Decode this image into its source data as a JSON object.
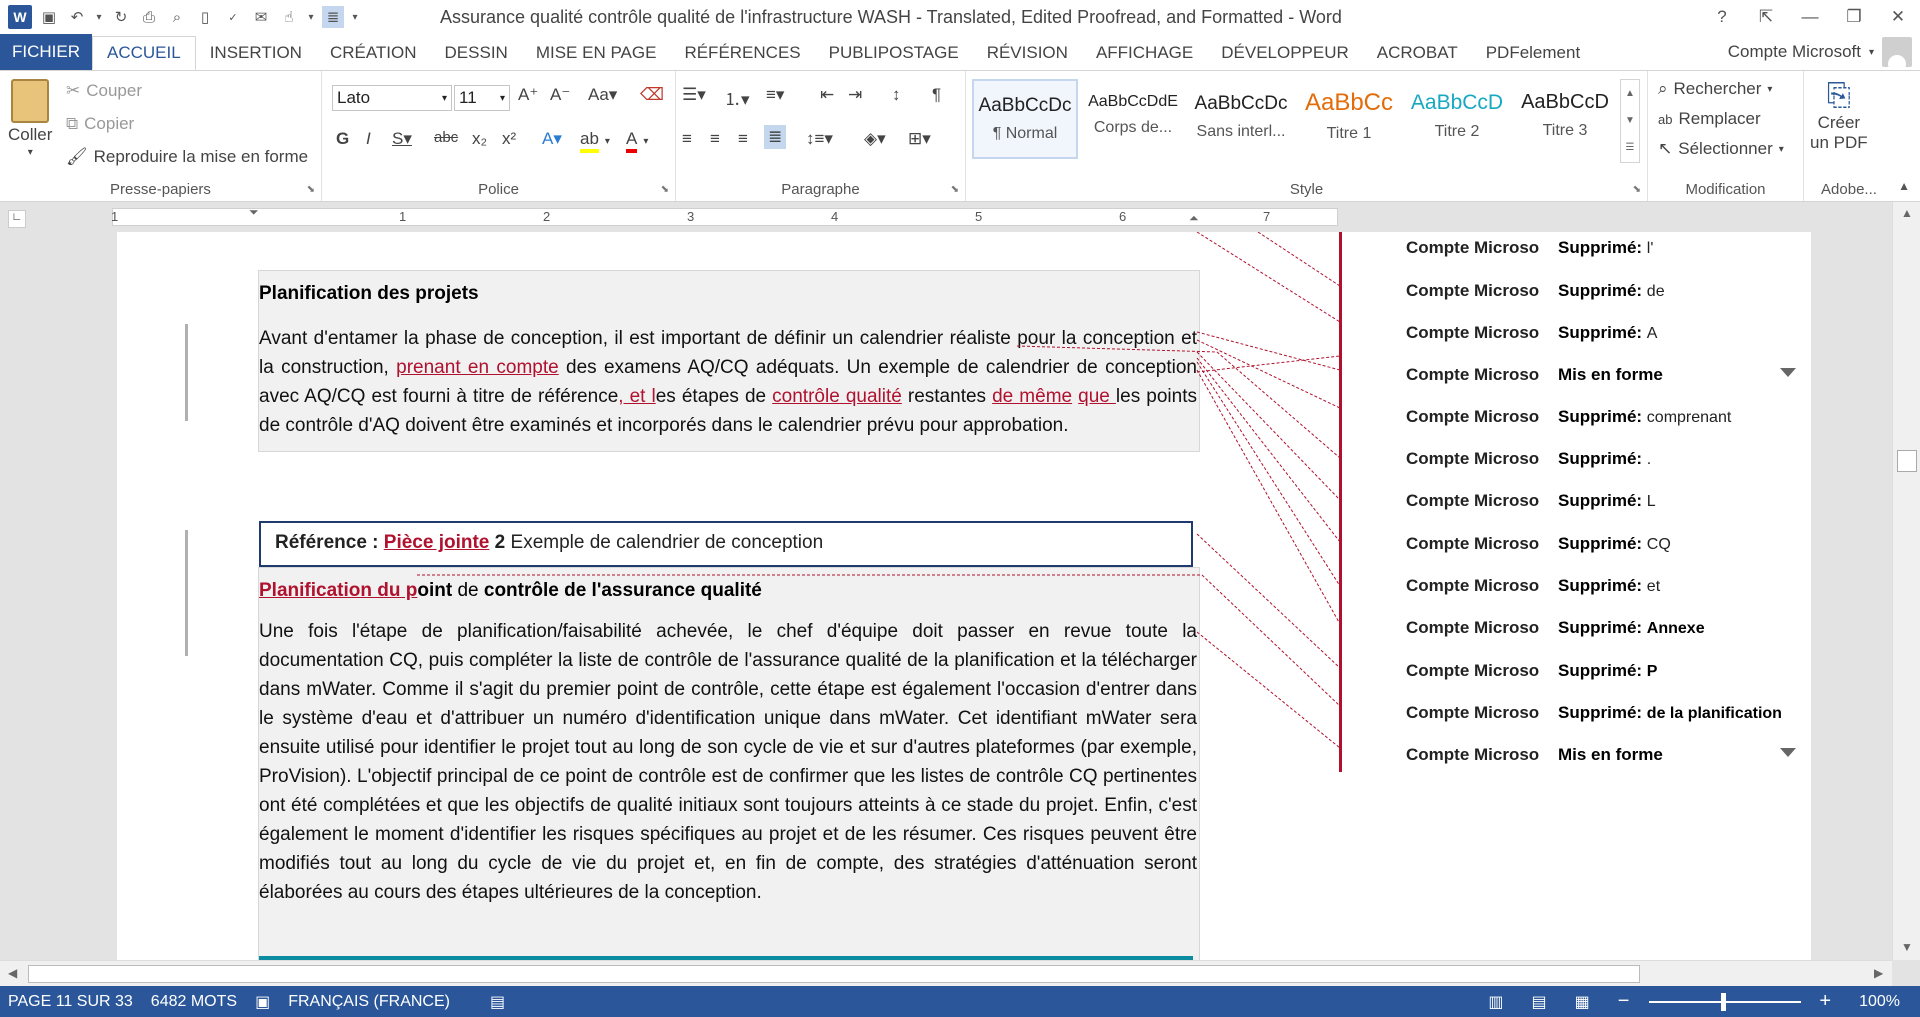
{
  "window": {
    "title": "Assurance qualité  contrôle qualité de l'infrastructure WASH - Translated, Edited Proofread, and Formatted - Word",
    "help": "?",
    "minimize": "—",
    "maximize": "❐",
    "close": "✕"
  },
  "tabs": [
    "FICHIER",
    "ACCUEIL",
    "INSERTION",
    "CRÉATION",
    "DESSIN",
    "MISE EN PAGE",
    "RÉFÉRENCES",
    "PUBLIPOSTAGE",
    "RÉVISION",
    "AFFICHAGE",
    "DÉVELOPPEUR",
    "ACROBAT",
    "PDFelement"
  ],
  "account": "Compte Microsoft",
  "ribbon": {
    "clipboard": {
      "paste": "Coller",
      "cut": "Couper",
      "copy": "Copier",
      "format_painter": "Reproduire la mise en forme",
      "label": "Presse-papiers"
    },
    "font": {
      "name": "Lato",
      "size": "11",
      "label": "Police"
    },
    "paragraph": {
      "label": "Paragraphe"
    },
    "styles": {
      "label": "Style",
      "items": [
        {
          "preview": "AaBbCcDc",
          "name": "¶ Normal"
        },
        {
          "preview": "AaBbCcDdE",
          "name": "Corps de..."
        },
        {
          "preview": "AaBbCcDc",
          "name": "Sans interl..."
        },
        {
          "preview": "AaBbCc",
          "name": "Titre 1"
        },
        {
          "preview": "AaBbCcD",
          "name": "Titre 2"
        },
        {
          "preview": "AaBbCcD",
          "name": "Titre 3"
        }
      ]
    },
    "editing": {
      "find": "Rechercher",
      "replace": "Remplacer",
      "select": "Sélectionner",
      "label": "Modification"
    },
    "adobe": {
      "create_pdf_1": "Créer",
      "create_pdf_2": "un PDF",
      "label": "Adobe..."
    }
  },
  "ruler": [
    "1",
    "1",
    "2",
    "3",
    "4",
    "5",
    "6",
    "7"
  ],
  "document": {
    "heading1": "Planification des projets",
    "para1_a": "Avant d'entamer la phase de conception, il est important de définir un calendrier réaliste pour la conception et la construction, ",
    "para1_ins1": "prenant en compte",
    "para1_b": " des examens AQ/CQ adéquats. Un exemple de calendrier de conception avec AQ/CQ est fourni à titre de référence",
    "para1_ins2": ", et l",
    "para1_c": "es étapes de ",
    "para1_ins3": "contrôle qualité",
    "para1_d": " restantes ",
    "para1_ins4": "de même",
    "para1_e": " ",
    "para1_ins5": "que ",
    "para1_f": "les points de contrôle d'AQ doivent être examinés et incorporés dans le calendrier prévu pour approbation.",
    "ref_label": "Référence : ",
    "ref_ins": "Pièce jointe",
    "ref_num": " 2 ",
    "ref_text": "Exemple de calendrier de conception",
    "heading2_ins": "Planification du p",
    "heading2_a": "oint",
    "heading2_b": " de ",
    "heading2_c": "contrôle de l'assurance qualité",
    "para2": "Une fois l'étape de planification/faisabilité achevée, le chef d'équipe doit passer en revue toute la documentation CQ, puis compléter la liste de contrôle de l'assurance qualité de la planification et la télécharger dans mWater. Comme il s'agit du premier point de contrôle, cette étape est également l'occasion d'entrer dans le système d'eau et d'attribuer un numéro d'identification unique dans mWater. Cet identifiant mWater sera ensuite utilisé pour identifier le projet tout au long de son cycle de vie et sur d'autres plateformes (par exemple, ProVision). L'objectif principal de ce point de contrôle est de confirmer que les listes de contrôle CQ pertinentes ont été complétées et que les objectifs de qualité initiaux sont toujours atteints à ce stade du projet. Enfin, c'est également le moment d'identifier les risques spécifiques au projet et de les résumer. Ces risques peuvent être modifiés tout au long du cycle de vie du projet et, en fin de compte, des stratégies d'atténuation seront élaborées au cours des étapes ultérieures de la conception."
  },
  "revisions": [
    {
      "author": "Compte Microso",
      "kind": "Supprimé:",
      "text": "l'"
    },
    {
      "author": "Compte Microso",
      "kind": "Supprimé:",
      "text": "de"
    },
    {
      "author": "Compte Microso",
      "kind": "Supprimé:",
      "text": "A"
    },
    {
      "author": "Compte Microso",
      "kind": "Mis en forme",
      "text": ""
    },
    {
      "author": "Compte Microso",
      "kind": "Supprimé:",
      "text": "comprenant"
    },
    {
      "author": "Compte Microso",
      "kind": "Supprimé:",
      "text": "."
    },
    {
      "author": "Compte Microso",
      "kind": "Supprimé:",
      "text": "L"
    },
    {
      "author": "Compte Microso",
      "kind": "Supprimé:",
      "text": "CQ"
    },
    {
      "author": "Compte Microso",
      "kind": "Supprimé:",
      "text": "et"
    },
    {
      "author": "Compte Microso",
      "kind": "Supprimé:",
      "text": "Annexe"
    },
    {
      "author": "Compte Microso",
      "kind": "Supprimé:",
      "text": "P"
    },
    {
      "author": "Compte Microso",
      "kind": "Supprimé:",
      "text": " de la planification"
    },
    {
      "author": "Compte Microso",
      "kind": "Mis en forme",
      "text": ""
    }
  ],
  "status": {
    "page": "PAGE 11 SUR 33",
    "words": "6482 MOTS",
    "language": "FRANÇAIS (FRANCE)",
    "zoom": "100%",
    "zoom_minus": "−",
    "zoom_plus": "+"
  },
  "colors": {
    "accent": "#2b579a",
    "insertion": "#b0112e"
  }
}
